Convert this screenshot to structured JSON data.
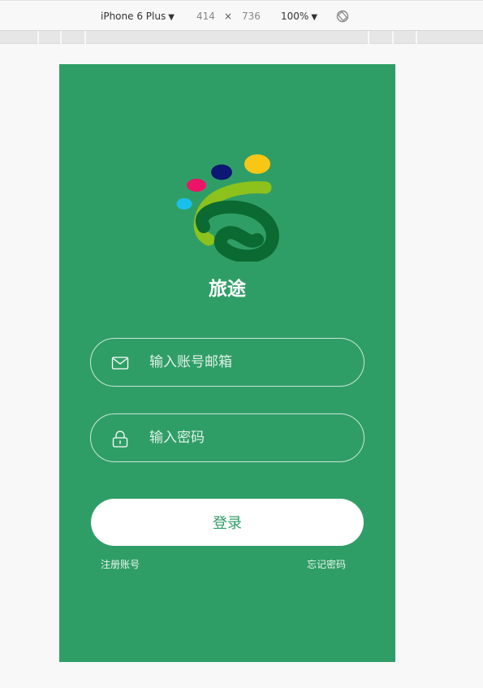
{
  "toolbar": {
    "device": "iPhone 6 Plus",
    "width": "414",
    "times": "×",
    "height": "736",
    "zoom": "100%",
    "caret_icon": "triangle-down-icon",
    "rotate_icon": "rotate-icon"
  },
  "app": {
    "title": "旅途",
    "colors": {
      "background": "#2f9e66",
      "dot_pink": "#ec1466",
      "dot_navy": "#0d1872",
      "dot_yellow": "#f8c615",
      "dot_cyan": "#1ac0ec",
      "arc_lime": "#8cc21b",
      "arc_dark": "#0b6a31"
    }
  },
  "login": {
    "email_placeholder": "输入账号邮箱",
    "email_icon": "envelope-icon",
    "password_placeholder": "输入密码",
    "password_icon": "lock-icon",
    "submit_label": "登录",
    "register_link": "注册账号",
    "forgot_link": "忘记密码"
  }
}
